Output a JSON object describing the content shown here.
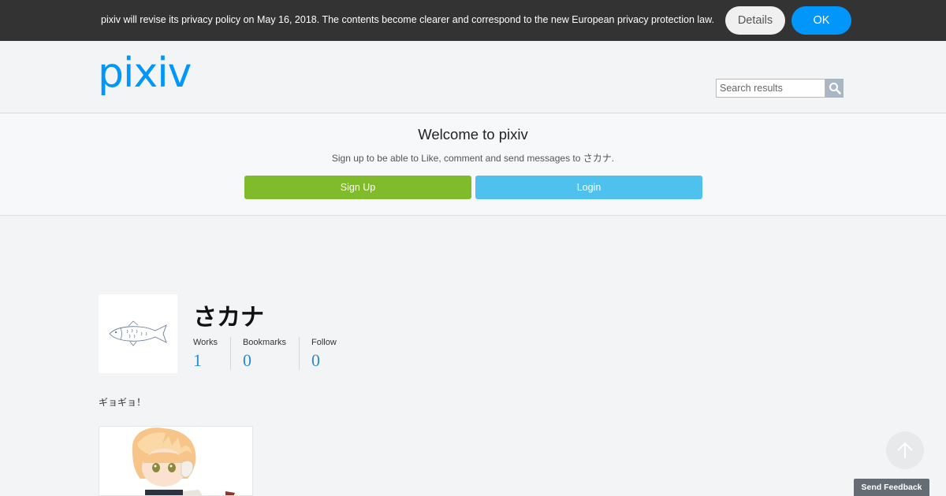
{
  "notice": {
    "text": "pixiv will revise its privacy policy on May 16, 2018. The contents become clearer and correspond to the new European privacy protection law.",
    "details_label": "Details",
    "ok_label": "OK"
  },
  "header": {
    "logo_text": "pixiv",
    "search_placeholder": "Search results",
    "search_icon": "search-icon"
  },
  "welcome": {
    "title": "Welcome to pixiv",
    "subtitle": "Sign up to be able to Like, comment and send messages to さカナ.",
    "signup_label": "Sign Up",
    "login_label": "Login"
  },
  "profile": {
    "name": "さカナ",
    "avatar_icon": "fish-icon",
    "stats": [
      {
        "label": "Works",
        "value": "1"
      },
      {
        "label": "Bookmarks",
        "value": "0"
      },
      {
        "label": "Follow",
        "value": "0"
      }
    ],
    "comment": "ギョギョ！"
  },
  "floating": {
    "scroll_top_icon": "arrow-up-icon",
    "feedback_label": "Send Feedback"
  },
  "colors": {
    "notice_bg": "#333333",
    "ok_blue": "#0096fa",
    "logo_blue": "#0096fa",
    "signup_green": "#7fbb2b",
    "login_blue": "#4fc1ef",
    "stat_blue": "#2b8ccb"
  }
}
